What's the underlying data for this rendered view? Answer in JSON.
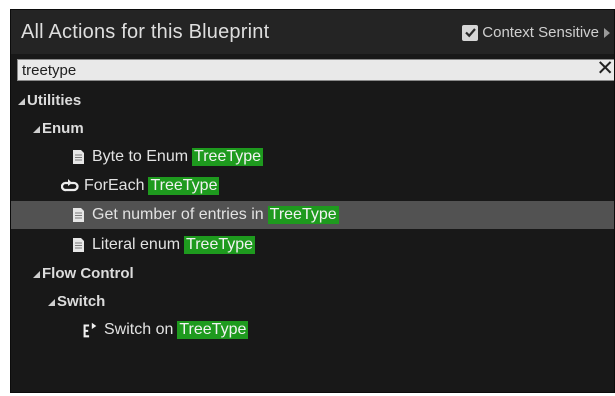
{
  "header": {
    "title": "All Actions for this Blueprint",
    "context_label": "Context Sensitive",
    "context_checked": true,
    "icons": {
      "checkbox": "checkmark-icon",
      "expand": "triangle-right-icon"
    }
  },
  "search": {
    "value": "treetype",
    "clear_icon": "close-x-icon"
  },
  "highlight_color": "#1e9a1e",
  "tree": {
    "utilities": {
      "label": "Utilities"
    },
    "enum": {
      "label": "Enum",
      "items": [
        {
          "prefix": "Byte to Enum",
          "match": "TreeType",
          "icon": "function-book-icon"
        },
        {
          "prefix": "ForEach",
          "match": "TreeType",
          "icon": "loop-arrow-icon"
        },
        {
          "prefix": "Get number of entries in",
          "match": "TreeType",
          "icon": "function-book-icon",
          "selected": true
        },
        {
          "prefix": "Literal enum",
          "match": "TreeType",
          "icon": "function-book-icon"
        }
      ]
    },
    "flow_control": {
      "label": "Flow Control"
    },
    "switch": {
      "label": "Switch",
      "items": [
        {
          "prefix": "Switch on",
          "match": "TreeType",
          "icon": "switch-exec-icon"
        }
      ]
    }
  }
}
